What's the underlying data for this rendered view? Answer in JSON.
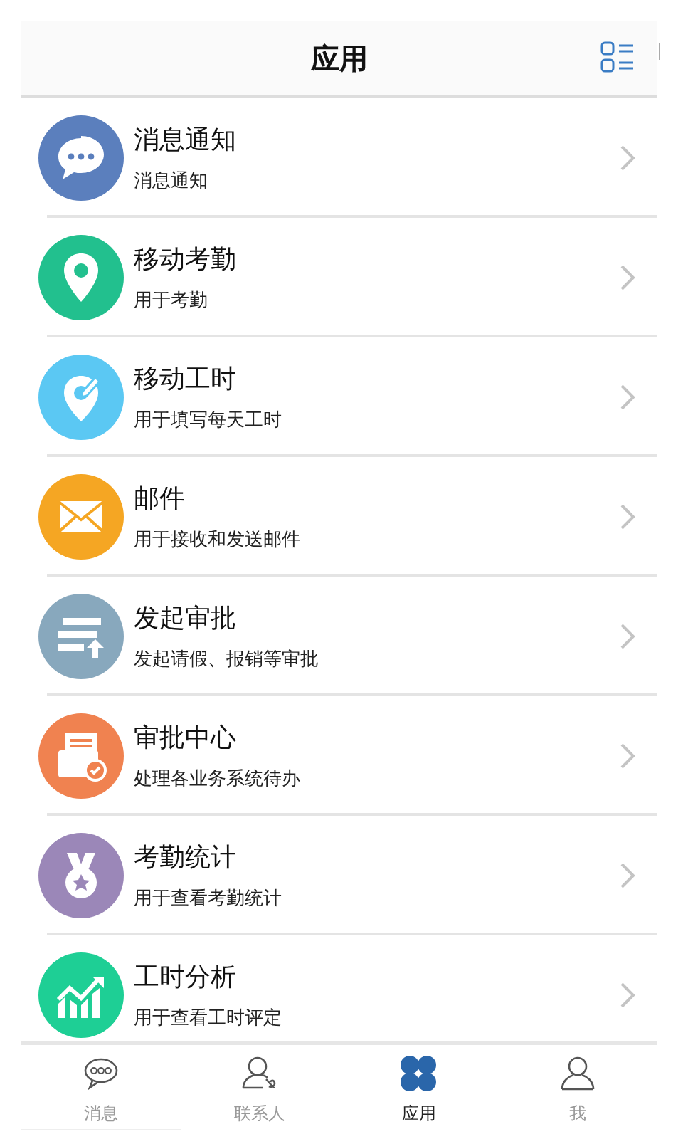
{
  "header": {
    "title": "应用"
  },
  "apps": [
    {
      "kind": "chat",
      "color": "#5b7fbd",
      "title": "消息通知",
      "subtitle": "消息通知"
    },
    {
      "kind": "pin",
      "color": "#22c08e",
      "title": "移动考勤",
      "subtitle": "用于考勤"
    },
    {
      "kind": "edit-pin",
      "color": "#5bc8f3",
      "title": "移动工时",
      "subtitle": "用于填写每天工时"
    },
    {
      "kind": "mail",
      "color": "#f5a623",
      "title": "邮件",
      "subtitle": "用于接收和发送邮件"
    },
    {
      "kind": "form",
      "color": "#88a8bd",
      "title": "发起审批",
      "subtitle": "发起请假、报销等审批"
    },
    {
      "kind": "approval",
      "color": "#f08250",
      "title": "审批中心",
      "subtitle": "处理各业务系统待办"
    },
    {
      "kind": "medal",
      "color": "#9b87b8",
      "title": "考勤统计",
      "subtitle": "用于查看考勤统计"
    },
    {
      "kind": "chart",
      "color": "#1ecf95",
      "title": "工时分析",
      "subtitle": "用于查看工时评定"
    }
  ],
  "tabs": [
    {
      "kind": "chat",
      "label": "消息",
      "selected": false
    },
    {
      "kind": "contacts",
      "label": "联系人",
      "selected": false
    },
    {
      "kind": "apps",
      "label": "应用",
      "selected": true
    },
    {
      "kind": "me",
      "label": "我",
      "selected": false
    }
  ]
}
